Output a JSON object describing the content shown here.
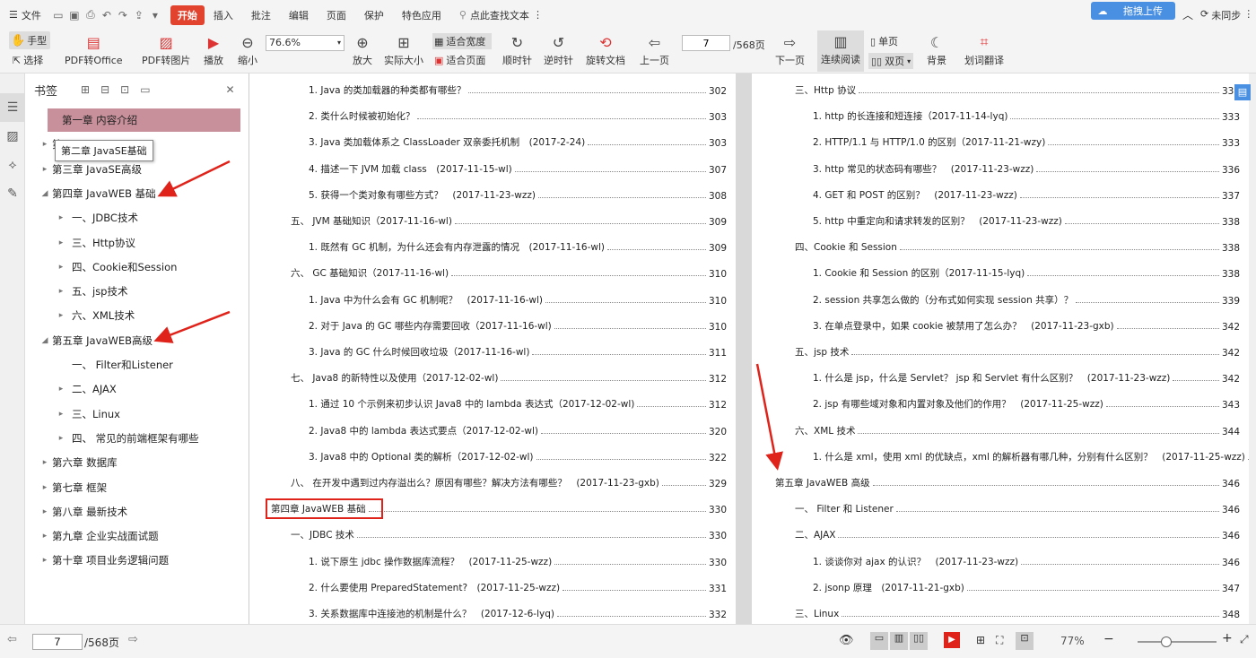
{
  "menu": {
    "file": "文件",
    "tabs": [
      "开始",
      "插入",
      "批注",
      "编辑",
      "页面",
      "保护",
      "特色应用"
    ],
    "search": "点此查找文本",
    "upload": "拖拽上传",
    "cloud": "未同步"
  },
  "toolbar": {
    "hand": "手型",
    "select": "选择",
    "pdf_office": "PDF转Office",
    "pdf_image": "PDF转图片",
    "play": "播放",
    "zoom_out": "缩小",
    "zoom_value": "76.6%",
    "zoom_in": "放大",
    "actual_size": "实际大小",
    "fit_width": "适合宽度",
    "fit_page": "适合页面",
    "rotate_cw": "顺时针",
    "rotate_ccw": "逆时针",
    "rotate_doc": "旋转文档",
    "prev": "上一页",
    "page_value": "7",
    "page_total": "/568页",
    "next": "下一页",
    "continuous": "连续阅读",
    "single": "单页",
    "double": "双页",
    "background": "背景",
    "translate": "划词翻译"
  },
  "bookmarks": {
    "title": "书签",
    "tooltip": "第二章 JavaSE基础",
    "items": [
      {
        "label": "第一章 内容介绍",
        "arrow": "",
        "indent": 0,
        "selected": true
      },
      {
        "label": "第",
        "arrow": "▸",
        "indent": 0
      },
      {
        "label": "第三章 JavaSE高级",
        "arrow": "▸",
        "indent": 0
      },
      {
        "label": "第四章 JavaWEB 基础",
        "arrow": "◢",
        "indent": 0
      },
      {
        "label": "一、JDBC技术",
        "arrow": "▸",
        "indent": 1
      },
      {
        "label": "三、Http协议",
        "arrow": "▸",
        "indent": 1
      },
      {
        "label": "四、Cookie和Session",
        "arrow": "▸",
        "indent": 1
      },
      {
        "label": "五、jsp技术",
        "arrow": "▸",
        "indent": 1
      },
      {
        "label": "六、XML技术",
        "arrow": "▸",
        "indent": 1
      },
      {
        "label": "第五章 JavaWEB高级",
        "arrow": "◢",
        "indent": 0
      },
      {
        "label": "一、 Filter和Listener",
        "arrow": "",
        "indent": 1
      },
      {
        "label": "二、AJAX",
        "arrow": "▸",
        "indent": 1
      },
      {
        "label": "三、Linux",
        "arrow": "▸",
        "indent": 1
      },
      {
        "label": "四、 常见的前端框架有哪些",
        "arrow": "▸",
        "indent": 1
      },
      {
        "label": "第六章 数据库",
        "arrow": "▸",
        "indent": 0
      },
      {
        "label": "第七章 框架",
        "arrow": "▸",
        "indent": 0
      },
      {
        "label": "第八章 最新技术",
        "arrow": "▸",
        "indent": 0
      },
      {
        "label": "第九章 企业实战面试题",
        "arrow": "▸",
        "indent": 0
      },
      {
        "label": "第十章 项目业务逻辑问题",
        "arrow": "▸",
        "indent": 0
      }
    ]
  },
  "left_page": [
    {
      "text": "1. Java 的类加载器的种类都有哪些？",
      "page": "302",
      "indent": 2
    },
    {
      "text": "2. 类什么时候被初始化？",
      "page": "303",
      "indent": 2
    },
    {
      "text": "3. Java 类加载体系之 ClassLoader 双亲委托机制　(2017-2-24)",
      "page": "303",
      "indent": 2
    },
    {
      "text": "4. 描述一下 JVM 加载 class　(2017-11-15-wl)",
      "page": "307",
      "indent": 2
    },
    {
      "text": "5. 获得一个类对象有哪些方式？　(2017-11-23-wzz)",
      "page": "308",
      "indent": 2
    },
    {
      "text": "五、 JVM 基础知识（2017-11-16-wl)",
      "page": "309",
      "indent": 1
    },
    {
      "text": "1. 既然有 GC 机制，为什么还会有内存泄露的情况　(2017-11-16-wl)",
      "page": "309",
      "indent": 2
    },
    {
      "text": "六、 GC 基础知识（2017-11-16-wl)",
      "page": "310",
      "indent": 1
    },
    {
      "text": "1. Java 中为什么会有 GC 机制呢？　(2017-11-16-wl)",
      "page": "310",
      "indent": 2
    },
    {
      "text": "2. 对于 Java 的 GC 哪些内存需要回收（2017-11-16-wl)",
      "page": "310",
      "indent": 2
    },
    {
      "text": "3. Java 的 GC 什么时候回收垃圾（2017-11-16-wl)",
      "page": "311",
      "indent": 2
    },
    {
      "text": "七、 Java8 的新特性以及使用（2017-12-02-wl)",
      "page": "312",
      "indent": 1
    },
    {
      "text": "1. 通过 10 个示例来初步认识 Java8 中的 lambda 表达式（2017-12-02-wl)",
      "page": "312",
      "indent": 2
    },
    {
      "text": "2. Java8 中的 lambda 表达式要点（2017-12-02-wl)",
      "page": "320",
      "indent": 2
    },
    {
      "text": "3. Java8 中的 Optional 类的解析（2017-12-02-wl)",
      "page": "322",
      "indent": 2
    },
    {
      "text": "八、 在开发中遇到过内存溢出么？原因有哪些？解决方法有哪些？　(2017-11-23-gxb)",
      "page": "329",
      "indent": 1
    },
    {
      "text": "第四章 JavaWEB 基础",
      "page": "330",
      "indent": 0
    },
    {
      "text": "一、JDBC 技术",
      "page": "330",
      "indent": 1
    },
    {
      "text": "1. 说下原生 jdbc 操作数据库流程？　(2017-11-25-wzz)",
      "page": "330",
      "indent": 2
    },
    {
      "text": "2. 什么要使用 PreparedStatement?　(2017-11-25-wzz)",
      "page": "331",
      "indent": 2
    },
    {
      "text": "3. 关系数据库中连接池的机制是什么？　(2017-12-6-lyq)",
      "page": "332",
      "indent": 2
    }
  ],
  "right_page": [
    {
      "text": "三、Http 协议",
      "page": "333",
      "indent": 1
    },
    {
      "text": "1. http 的长连接和短连接（2017-11-14-lyq)",
      "page": "333",
      "indent": 2
    },
    {
      "text": "2. HTTP/1.1 与 HTTP/1.0 的区别（2017-11-21-wzy)",
      "page": "333",
      "indent": 2
    },
    {
      "text": "3. http 常见的状态码有哪些？　(2017-11-23-wzz)",
      "page": "336",
      "indent": 2
    },
    {
      "text": "4. GET 和 POST 的区别？　(2017-11-23-wzz)",
      "page": "337",
      "indent": 2
    },
    {
      "text": "5. http 中重定向和请求转发的区别？　(2017-11-23-wzz)",
      "page": "338",
      "indent": 2
    },
    {
      "text": "四、Cookie 和 Session",
      "page": "338",
      "indent": 1
    },
    {
      "text": "1. Cookie 和 Session 的区别（2017-11-15-lyq)",
      "page": "338",
      "indent": 2
    },
    {
      "text": "2. session 共享怎么做的（分布式如何实现 session 共享）？",
      "page": "339",
      "indent": 2
    },
    {
      "text": "3. 在单点登录中，如果 cookie 被禁用了怎么办？　(2017-11-23-gxb)",
      "page": "342",
      "indent": 2
    },
    {
      "text": "五、jsp 技术",
      "page": "342",
      "indent": 1
    },
    {
      "text": "1. 什么是 jsp，什么是 Servlet？ jsp 和 Servlet 有什么区别？　(2017-11-23-wzz)",
      "page": "342",
      "indent": 2
    },
    {
      "text": "2. jsp 有哪些域对象和内置对象及他们的作用？　(2017-11-25-wzz)",
      "page": "343",
      "indent": 2
    },
    {
      "text": "六、XML 技术",
      "page": "344",
      "indent": 1
    },
    {
      "text": "1. 什么是 xml，使用 xml 的优缺点，xml 的解析器有哪几种，分别有什么区别？　(2017-11-25-wzz)",
      "page": "344",
      "indent": 2
    },
    {
      "text": "第五章 JavaWEB 高级",
      "page": "346",
      "indent": 0
    },
    {
      "text": "一、 Filter 和 Listener",
      "page": "346",
      "indent": 1
    },
    {
      "text": "二、AJAX",
      "page": "346",
      "indent": 1
    },
    {
      "text": "1. 谈谈你对 ajax 的认识？　(2017-11-23-wzz)",
      "page": "346",
      "indent": 2
    },
    {
      "text": "2. jsonp 原理　(2017-11-21-gxb)",
      "page": "347",
      "indent": 2
    },
    {
      "text": "三、Linux",
      "page": "348",
      "indent": 1
    }
  ],
  "status": {
    "page_value": "7",
    "page_total": "/568页",
    "zoom": "77%"
  },
  "colors": {
    "accent": "#e2432f",
    "annotation_red": "#e0231a",
    "selected_bookmark": "#c8909a"
  }
}
